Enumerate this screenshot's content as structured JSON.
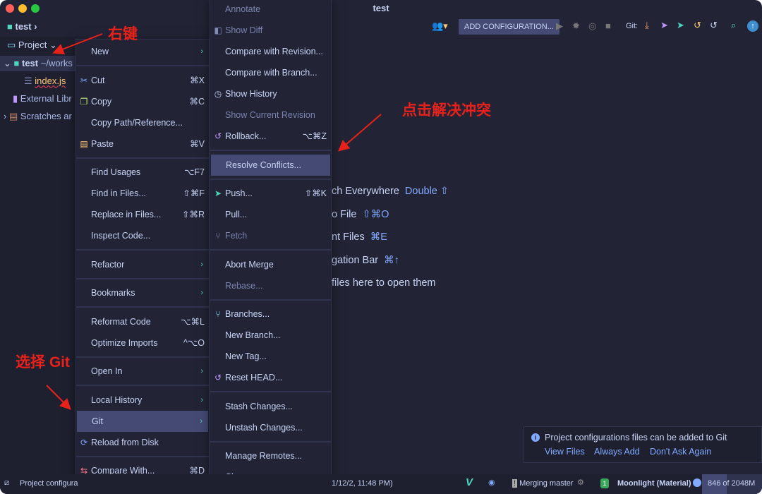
{
  "window": {
    "title": "test"
  },
  "navbar": {
    "project": "test"
  },
  "toolbar": {
    "add_config": "ADD CONFIGURATION...",
    "git_label": "Git:"
  },
  "project_panel": {
    "header": "Project",
    "root": "test",
    "root_path": "~/works",
    "file": "index.js",
    "external": "External Libr",
    "scratches": "Scratches ar"
  },
  "context_menu": [
    {
      "label": "New",
      "arrow": true
    },
    {
      "sep": true
    },
    {
      "label": "Cut",
      "shortcut": "⌘X",
      "icon": "scissors"
    },
    {
      "label": "Copy",
      "shortcut": "⌘C",
      "icon": "copy"
    },
    {
      "label": "Copy Path/Reference..."
    },
    {
      "label": "Paste",
      "shortcut": "⌘V",
      "icon": "clipboard"
    },
    {
      "sep": true
    },
    {
      "label": "Find Usages",
      "shortcut": "⌥F7"
    },
    {
      "label": "Find in Files...",
      "shortcut": "⇧⌘F"
    },
    {
      "label": "Replace in Files...",
      "shortcut": "⇧⌘R"
    },
    {
      "label": "Inspect Code..."
    },
    {
      "sep": true
    },
    {
      "label": "Refactor",
      "arrow": true
    },
    {
      "sep": true
    },
    {
      "label": "Bookmarks",
      "arrow": true
    },
    {
      "sep": true
    },
    {
      "label": "Reformat Code",
      "shortcut": "⌥⌘L"
    },
    {
      "label": "Optimize Imports",
      "shortcut": "^⌥O"
    },
    {
      "sep": true
    },
    {
      "label": "Open In",
      "arrow": true
    },
    {
      "sep": true
    },
    {
      "label": "Local History",
      "arrow": true
    },
    {
      "label": "Git",
      "arrow": true,
      "selected": true
    },
    {
      "label": "Reload from Disk",
      "icon": "reload"
    },
    {
      "sep": true
    },
    {
      "label": "Compare With...",
      "shortcut": "⌘D",
      "icon": "compare"
    },
    {
      "sep": true
    }
  ],
  "git_menu": [
    {
      "label": "Annotate",
      "disabled": true
    },
    {
      "label": "Show Diff",
      "disabled": true,
      "icon": "diff"
    },
    {
      "label": "Compare with Revision..."
    },
    {
      "label": "Compare with Branch..."
    },
    {
      "label": "Show History",
      "icon": "history"
    },
    {
      "label": "Show Current Revision",
      "disabled": true
    },
    {
      "label": "Rollback...",
      "shortcut": "⌥⌘Z",
      "icon": "rollback"
    },
    {
      "sep": true
    },
    {
      "label": "Resolve Conflicts...",
      "selected": true
    },
    {
      "sep": true
    },
    {
      "label": "Push...",
      "shortcut": "⇧⌘K",
      "icon": "push"
    },
    {
      "label": "Pull..."
    },
    {
      "label": "Fetch",
      "disabled": true,
      "icon": "fetch"
    },
    {
      "sep": true
    },
    {
      "label": "Abort Merge"
    },
    {
      "label": "Rebase...",
      "disabled": true
    },
    {
      "sep": true
    },
    {
      "label": "Branches...",
      "icon": "branch"
    },
    {
      "label": "New Branch..."
    },
    {
      "label": "New Tag..."
    },
    {
      "label": "Reset HEAD...",
      "icon": "rollback"
    },
    {
      "sep": true
    },
    {
      "label": "Stash Changes..."
    },
    {
      "label": "Unstash Changes..."
    },
    {
      "sep": true
    },
    {
      "label": "Manage Remotes..."
    },
    {
      "label": "Clone..."
    }
  ],
  "welcome": [
    {
      "text": "ch Everywhere",
      "key": "Double ⇧"
    },
    {
      "text": "o File",
      "key": "⇧⌘O"
    },
    {
      "text": "nt Files",
      "key": "⌘E"
    },
    {
      "text": "gation Bar",
      "key": "⌘↑"
    },
    {
      "text": "files here to open them",
      "key": ""
    }
  ],
  "notification": {
    "text": "Project configurations files can be added to Git",
    "actions": [
      "View Files",
      "Always Add",
      "Don't Ask Again"
    ]
  },
  "status": {
    "left": "Project configura",
    "time": "1/12/2, 11:48 PM)",
    "merging": "Merging master",
    "badge": "1",
    "theme": "Moonlight (Material)",
    "memory": "846 of 2048M",
    "memory_fraction": 0.41
  },
  "annotations": {
    "right_click": "右键",
    "resolve": "点击解决冲突",
    "select_git": "选择 Git"
  },
  "colors": {
    "bg": "#222436",
    "selected": "#444a73",
    "accent": "#82aaff",
    "annotation": "#e8211a"
  }
}
